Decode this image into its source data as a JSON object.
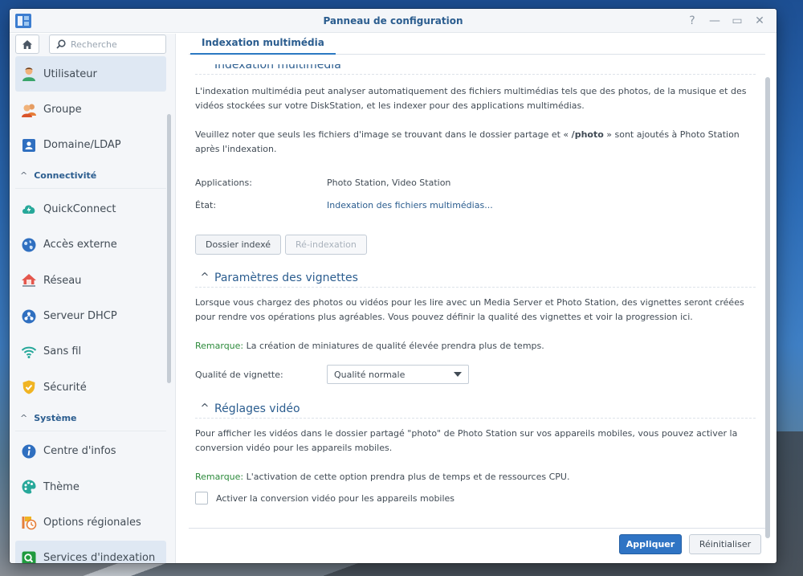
{
  "window": {
    "title": "Panneau de configuration",
    "controls": [
      "?",
      "—",
      "▭",
      "✕"
    ]
  },
  "sidebar": {
    "search_placeholder": "Recherche",
    "items": [
      {
        "label": "Utilisateur",
        "icon": "user-icon",
        "active": true
      },
      {
        "label": "Groupe",
        "icon": "group-icon"
      },
      {
        "label": "Domaine/LDAP",
        "icon": "domain-icon"
      }
    ],
    "section_connectivity": "Connectivité",
    "connectivity_items": [
      {
        "label": "QuickConnect",
        "icon": "quickconnect-icon"
      },
      {
        "label": "Accès externe",
        "icon": "globe-icon"
      },
      {
        "label": "Réseau",
        "icon": "network-icon"
      },
      {
        "label": "Serveur DHCP",
        "icon": "dhcp-icon"
      },
      {
        "label": "Sans fil",
        "icon": "wifi-icon"
      },
      {
        "label": "Sécurité",
        "icon": "shield-icon"
      }
    ],
    "section_system": "Système",
    "system_items": [
      {
        "label": "Centre d'infos",
        "icon": "info-icon"
      },
      {
        "label": "Thème",
        "icon": "palette-icon"
      },
      {
        "label": "Options régionales",
        "icon": "regional-icon"
      },
      {
        "label": "Services d'indexation",
        "icon": "indexing-icon",
        "selected": true
      }
    ]
  },
  "tab": {
    "label": "Indexation multimédia"
  },
  "media_index": {
    "heading": "Indexation multimédia",
    "para1": "L'indexation multimédia peut analyser automatiquement des fichiers multimédias tels que des photos, de la musique et des vidéos stockées sur votre DiskStation, et les indexer pour des applications multimédias.",
    "para2_pre": "Veuillez noter que seuls les fichiers d'image se trouvant dans le dossier partage et « ",
    "para2_bold": "/photo",
    "para2_post": " » sont ajoutés à Photo Station après l'indexation.",
    "apps_label": "Applications:",
    "apps_value": "Photo Station, Video Station",
    "state_label": "État:",
    "state_value": "Indexation des fichiers multimédias...",
    "btn_indexed": "Dossier indexé",
    "btn_reindex": "Ré-indexation"
  },
  "thumbnails": {
    "heading": "Paramètres des vignettes",
    "para": "Lorsque vous chargez des photos ou vidéos pour les lire avec un Media Server et Photo Station, des vignettes seront créées pour rendre vos opérations plus agréables. Vous pouvez définir la qualité des vignettes et voir la progression ici.",
    "remark_label": "Remarque:",
    "remark_text": " La création de miniatures de qualité élevée prendra plus de temps.",
    "quality_label": "Qualité de vignette:",
    "quality_value": "Qualité normale"
  },
  "video": {
    "heading": "Réglages vidéo",
    "para": "Pour afficher les vidéos dans le dossier partagé \"photo\" de Photo Station sur vos appareils mobiles, vous pouvez activer la conversion vidéo pour les appareils mobiles.",
    "remark_label": "Remarque:",
    "remark_text": " L'activation de cette option prendra plus de temps et de ressources CPU.",
    "checkbox_label": "Activer la conversion vidéo pour les appareils mobiles"
  },
  "footer": {
    "apply": "Appliquer",
    "reset": "Réinitialiser"
  },
  "colors": {
    "accent": "#2b5d8f",
    "primary_button": "#2f74c4",
    "remark": "#2c8a3b"
  }
}
